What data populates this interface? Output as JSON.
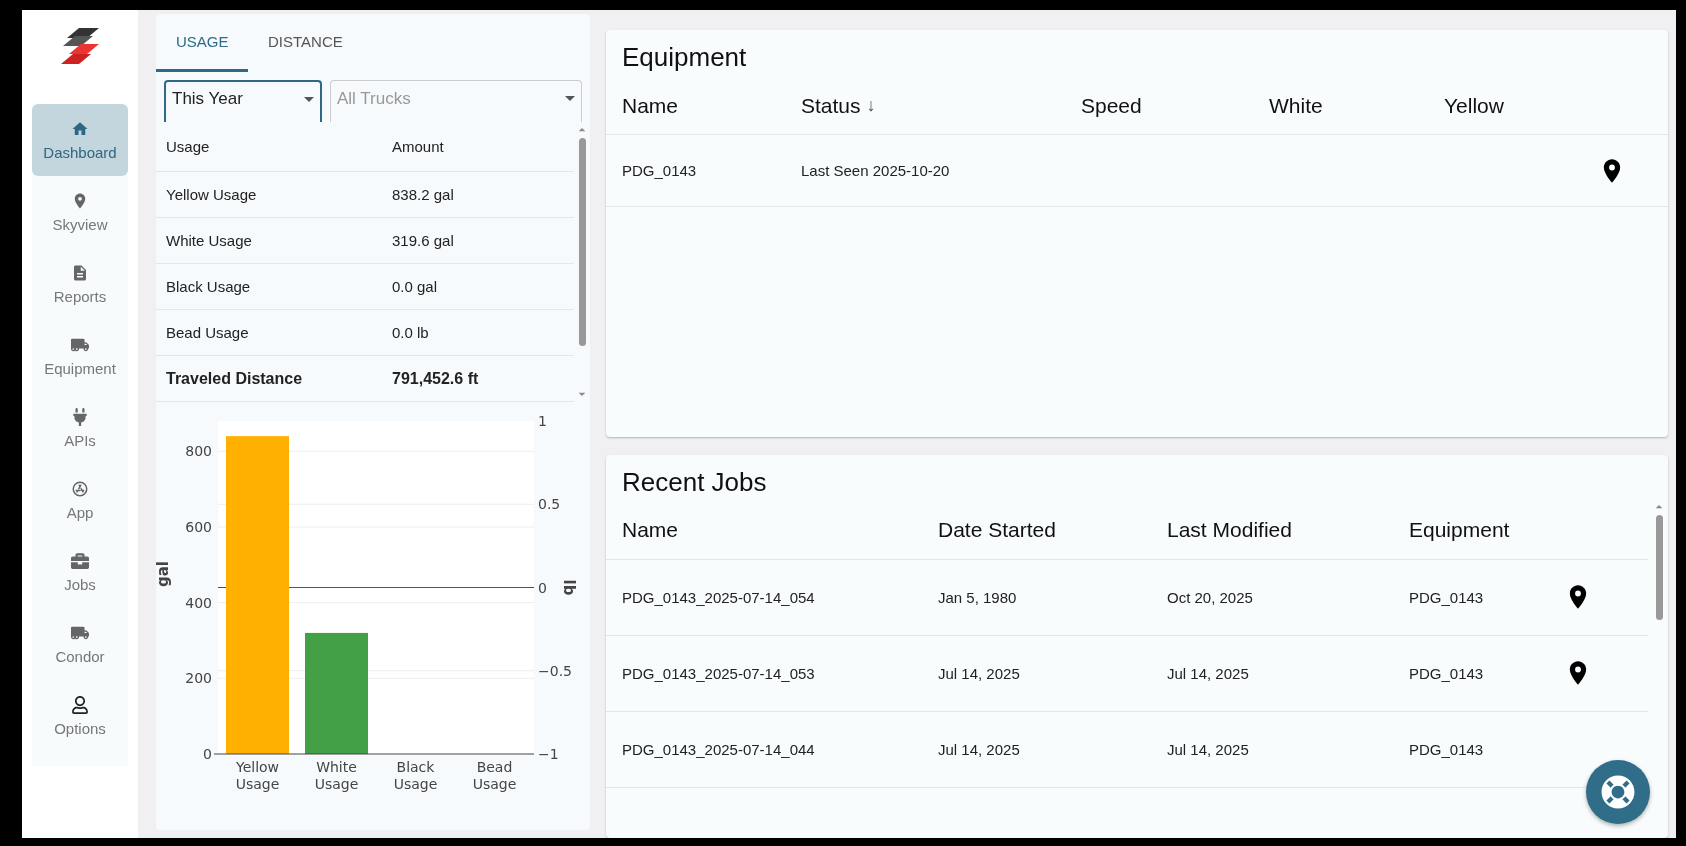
{
  "sidebar": {
    "items": [
      {
        "label": "Dashboard",
        "selected": true
      },
      {
        "label": "Skyview",
        "selected": false
      },
      {
        "label": "Reports",
        "selected": false
      },
      {
        "label": "Equipment",
        "selected": false
      },
      {
        "label": "APIs",
        "selected": false
      },
      {
        "label": "App",
        "selected": false
      },
      {
        "label": "Jobs",
        "selected": false
      },
      {
        "label": "Condor",
        "selected": false
      },
      {
        "label": "Options",
        "selected": false
      }
    ]
  },
  "usage_panel": {
    "tabs": [
      {
        "label": "USAGE",
        "selected": true
      },
      {
        "label": "DISTANCE",
        "selected": false
      }
    ],
    "period_select": {
      "value": "This Year"
    },
    "truck_select": {
      "placeholder": "All Trucks"
    },
    "table": {
      "columns": [
        "Usage",
        "Amount"
      ],
      "rows": [
        {
          "cells": [
            "Yellow Usage",
            "838.2 gal"
          ],
          "bold": false
        },
        {
          "cells": [
            "White Usage",
            "319.6 gal"
          ],
          "bold": false
        },
        {
          "cells": [
            "Black Usage",
            "0.0 gal"
          ],
          "bold": false
        },
        {
          "cells": [
            "Bead Usage",
            "0.0 lb"
          ],
          "bold": false
        },
        {
          "cells": [
            "Traveled Distance",
            "791,452.6 ft"
          ],
          "bold": true
        }
      ]
    },
    "chart_data": {
      "type": "bar",
      "categories": [
        "Yellow Usage",
        "White Usage",
        "Black Usage",
        "Bead Usage"
      ],
      "values": [
        840,
        320,
        0,
        0
      ],
      "grid": true,
      "ylabel": "gal",
      "ylim": [
        0,
        880
      ],
      "yticks": [
        0,
        200,
        400,
        600,
        800
      ],
      "y2label": "lb",
      "y2lim": [
        -1,
        1
      ],
      "y2ticks": [
        {
          "value": 1,
          "label": "1"
        },
        {
          "value": 0.5,
          "label": "0.5"
        },
        {
          "value": 0,
          "label": "0"
        },
        {
          "value": -0.5,
          "label": "−0.5"
        },
        {
          "value": -1,
          "label": "−1"
        }
      ]
    }
  },
  "equipment": {
    "title": "Equipment",
    "columns": [
      {
        "label": "Name"
      },
      {
        "label": "Status",
        "sort": "↓"
      },
      {
        "label": "Speed"
      },
      {
        "label": "White"
      },
      {
        "label": "Yellow"
      }
    ],
    "rows": [
      {
        "cells": [
          "PDG_0143",
          "Last Seen 2025-10-20",
          "",
          "",
          ""
        ]
      }
    ]
  },
  "recent_jobs": {
    "title": "Recent Jobs",
    "columns": [
      "Name",
      "Date Started",
      "Last Modified",
      "Equipment"
    ],
    "rows": [
      {
        "cells": [
          "PDG_0143_2025-07-14_054",
          "Jan 5, 1980",
          "Oct 20, 2025",
          "PDG_0143"
        ]
      },
      {
        "cells": [
          "PDG_0143_2025-07-14_053",
          "Jul 14, 2025",
          "Jul 14, 2025",
          "PDG_0143"
        ]
      },
      {
        "cells": [
          "PDG_0143_2025-07-14_044",
          "Jul 14, 2025",
          "Jul 14, 2025",
          "PDG_0143"
        ]
      }
    ]
  }
}
